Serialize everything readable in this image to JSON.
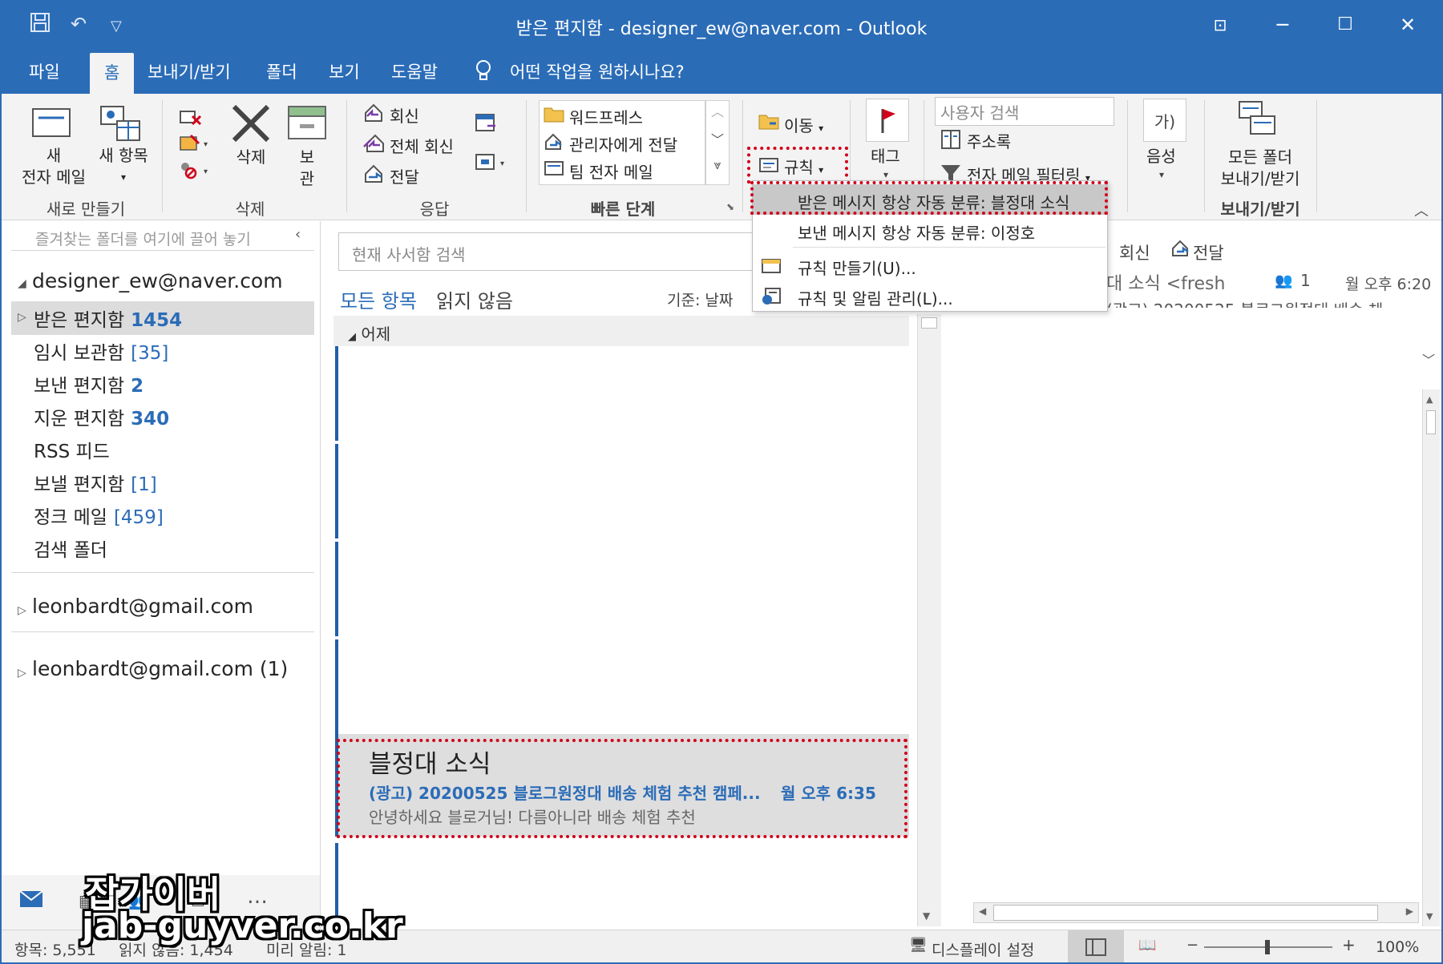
{
  "window": {
    "title": "받은 편지함 - designer_ew@naver.com  -  Outlook"
  },
  "menu": {
    "tabs": [
      "파일",
      "홈",
      "보내기/받기",
      "폴더",
      "보기",
      "도움말"
    ],
    "tell_me": "어떤 작업을 원하시나요?"
  },
  "ribbon": {
    "new_email_l1": "새",
    "new_email_l2": "전자 메일",
    "new_items": "새 항목",
    "group_new": "새로 만들기",
    "delete": "삭제",
    "archive_l1": "보",
    "archive_l2": "관",
    "group_delete": "삭제",
    "reply": "회신",
    "reply_all": "전체 회신",
    "forward": "전달",
    "group_respond": "응답",
    "quick_steps": [
      "워드프레스",
      "관리자에게 전달",
      "팀 전자 메일"
    ],
    "group_quick": "빠른 단계",
    "move": "이동",
    "rules": "규칙",
    "tags": "태그",
    "search_people_placeholder": "사용자 검색",
    "address_book": "주소록",
    "filter_email": "전자 메일 필터링",
    "speech": "음성",
    "send_receive_l1": "모든 폴더",
    "send_receive_l2": "보내기/받기",
    "group_send_receive": "보내기/받기"
  },
  "rules_menu": {
    "items": [
      "받은 메시지 항상 자동 분류: 블정대 소식",
      "보낸 메시지 항상 자동 분류: 이정호",
      "규칙 만들기(U)...",
      "규칙 및 알림 관리(L)..."
    ]
  },
  "folders": {
    "favorites_hint": "즐겨찾는 폴더를 여기에 끌어 놓기",
    "account1": "designer_ew@naver.com",
    "list": [
      {
        "name": "받은 편지함",
        "count": "1454"
      },
      {
        "name": "임시 보관함",
        "count": "[35]"
      },
      {
        "name": "보낸 편지함",
        "count": "2"
      },
      {
        "name": "지운 편지함",
        "count": "340"
      },
      {
        "name": "RSS 피드",
        "count": ""
      },
      {
        "name": "보낼 편지함",
        "count": "[1]"
      },
      {
        "name": "정크 메일",
        "count": "[459]"
      },
      {
        "name": "검색 폴더",
        "count": ""
      }
    ],
    "account2": "leonbardt@gmail.com",
    "account3": "leonbardt@gmail.com (1)"
  },
  "message_list": {
    "search_placeholder": "현재 사서함 검색",
    "tab_all": "모든 항목",
    "tab_unread": "읽지 않음",
    "sort_label": "기준: 날짜",
    "group_yesterday": "어제",
    "selected_message": {
      "from": "블정대 소식",
      "subject": "(광고) 20200525 블로그원정대 배송 체험 추천 캠페...",
      "time": "월 오후 6:35",
      "preview": "안녕하세요 블로거님! 다름아니라 배송 체험  추천"
    }
  },
  "reading_pane": {
    "reply": "회신",
    "forward": "전달",
    "from_partial": "대 소식 <fresh",
    "people": "1",
    "time": "월 오후 6:20",
    "subject_partial": "(광고) 20200525 블로그원정대 배송 체"
  },
  "status": {
    "items": "항목: 5,551",
    "unread": "읽지 않음: 1,454",
    "reminders": "미리 알림: 1",
    "display_settings": "디스플레이 설정",
    "zoom": "100%"
  },
  "watermark": {
    "line1": "잡가이버",
    "line2": "jab-guyver.co.kr"
  },
  "colors": {
    "accent": "#2b6cb7",
    "highlight": "#d0021b",
    "selected_row": "#dedede"
  }
}
